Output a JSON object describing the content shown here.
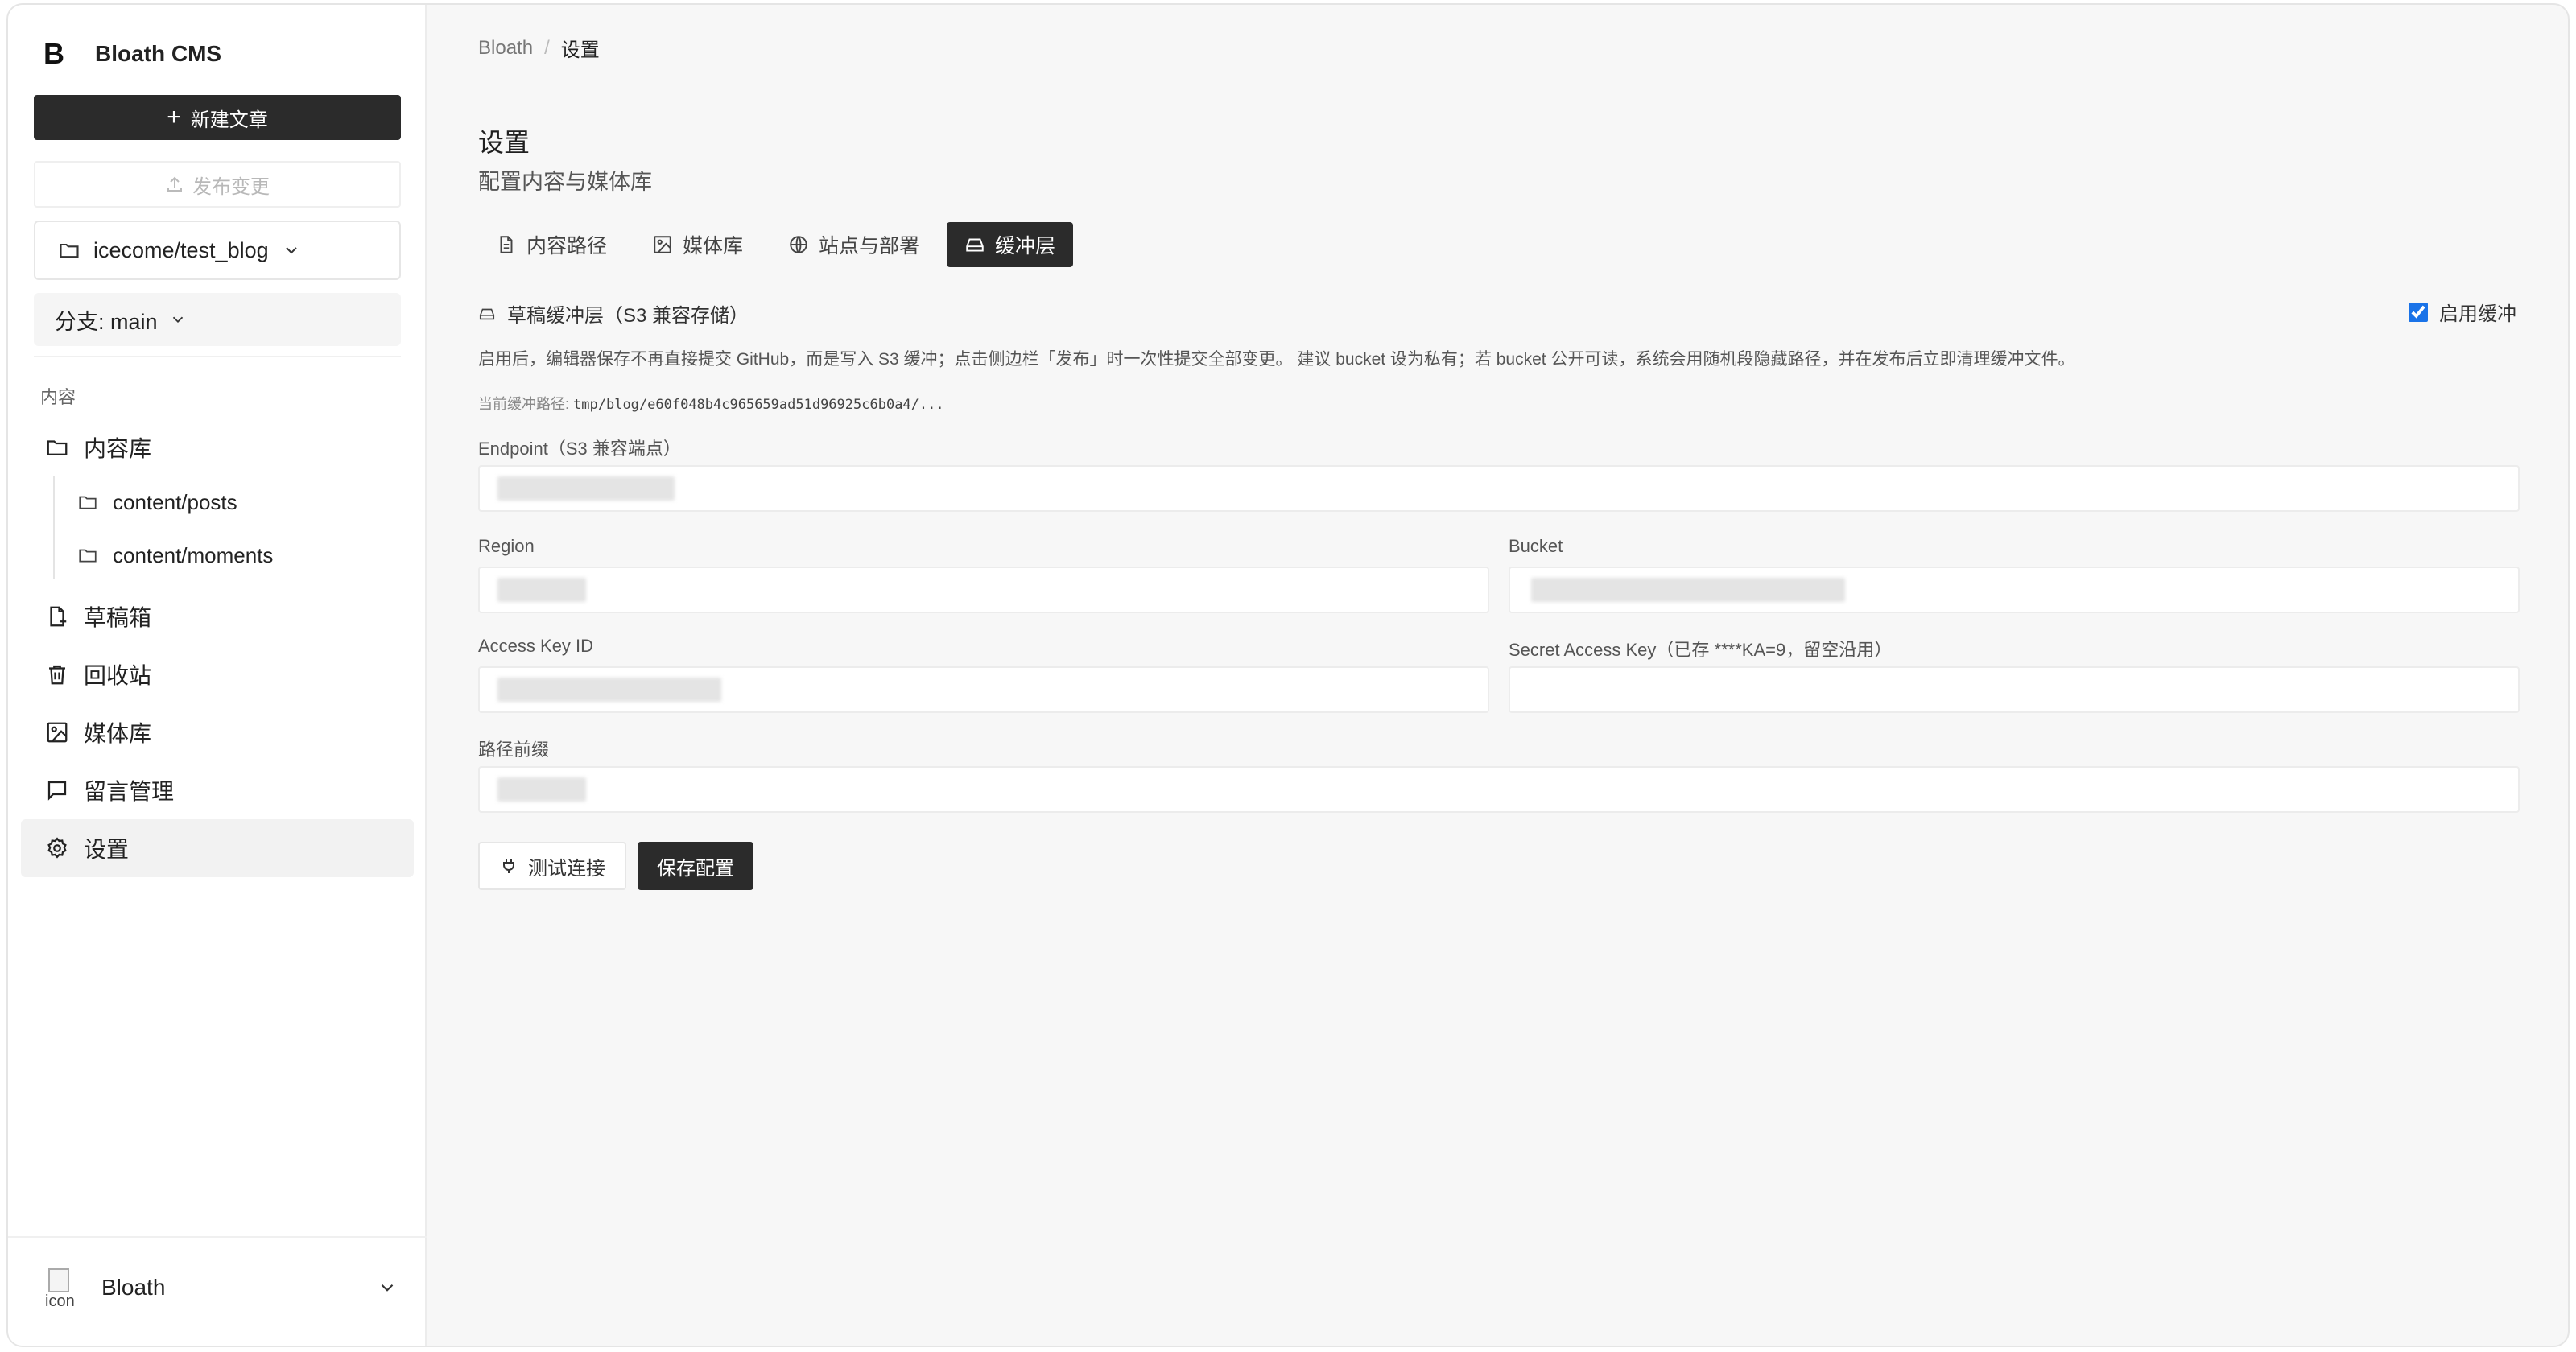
{
  "sidebar": {
    "brand_logo": "B",
    "brand_name": "Bloath CMS",
    "new_post_label": "新建文章",
    "publish_label": "发布变更",
    "repo_name": "icecome/test_blog",
    "branch_label": "分支: main",
    "section_label": "内容",
    "nav": {
      "library": "内容库",
      "posts": "content/posts",
      "moments": "content/moments",
      "drafts": "草稿箱",
      "trash": "回收站",
      "media": "媒体库",
      "comments": "留言管理",
      "settings": "设置"
    },
    "user": {
      "avatar_alt": "icon",
      "name": "Bloath"
    }
  },
  "breadcrumb": {
    "root": "Bloath",
    "separator": "/",
    "current": "设置"
  },
  "page": {
    "title": "设置",
    "subtitle": "配置内容与媒体库"
  },
  "tabs": [
    {
      "label": "内容路径",
      "icon": "file-text-icon",
      "active": false
    },
    {
      "label": "媒体库",
      "icon": "image-icon",
      "active": false
    },
    {
      "label": "站点与部署",
      "icon": "globe-icon",
      "active": false
    },
    {
      "label": "缓冲层",
      "icon": "hard-drive-icon",
      "active": true
    }
  ],
  "cache": {
    "heading": "草稿缓冲层（S3 兼容存储）",
    "enable_label": "启用缓冲",
    "enabled": true,
    "description": "启用后，编辑器保存不再直接提交 GitHub，而是写入 S3 缓冲；点击侧边栏「发布」时一次性提交全部变更。 建议 bucket 设为私有；若 bucket 公开可读，系统会用随机段隐藏路径，并在发布后立即清理缓冲文件。",
    "path_label": "当前缓冲路径:",
    "path_value": "tmp/blog/e60f048b4c965659ad51d96925c6b0a4/...",
    "fields": {
      "endpoint_label": "Endpoint（S3 兼容端点）",
      "region_label": "Region",
      "bucket_label": "Bucket",
      "access_key_label": "Access Key ID",
      "secret_key_label": "Secret Access Key（已存 ****KA=9，留空沿用）",
      "prefix_label": "路径前缀"
    },
    "test_button": "测试连接",
    "save_button": "保存配置"
  },
  "colors": {
    "primary": "#2b2b2b",
    "checkbox": "#1a73e8",
    "background": "#f7f7f7"
  }
}
